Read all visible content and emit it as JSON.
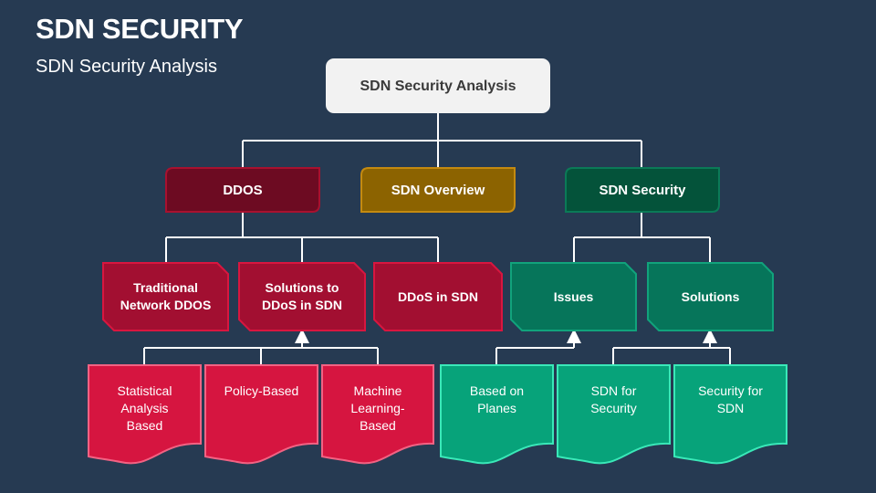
{
  "header": {
    "title": "SDN SECURITY",
    "subtitle": "SDN Security Analysis"
  },
  "colors": {
    "background": "#263a52",
    "connector": "#ffffff",
    "root_fill": "#f2f2f2",
    "ddos_fill": "#6d0b22",
    "ddos_stroke": "#a8112f",
    "overview_fill": "#8c6300",
    "overview_stroke": "#c48a10",
    "security_fill": "#04533a",
    "security_stroke": "#0b7a57",
    "red_mid_fill": "#a20f31",
    "red_mid_stroke": "#d9163f",
    "green_mid_fill": "#06755a",
    "green_mid_stroke": "#11a37c",
    "red_doc_fill": "#d61540",
    "red_doc_stroke": "#f26283",
    "green_doc_fill": "#07a37a",
    "green_doc_stroke": "#3ae8b8"
  },
  "diagram": {
    "root": {
      "label": "SDN Security Analysis"
    },
    "level1": [
      {
        "id": "ddos",
        "label": "DDOS"
      },
      {
        "id": "overview",
        "label": "SDN Overview"
      },
      {
        "id": "security",
        "label": "SDN Security"
      }
    ],
    "level2": [
      {
        "id": "traditional",
        "label": "Traditional Network DDOS",
        "parent": "ddos"
      },
      {
        "id": "solutions-ddos",
        "label": "Solutions to DDoS in SDN",
        "parent": "ddos"
      },
      {
        "id": "ddos-in-sdn",
        "label": "DDoS in SDN",
        "parent": "ddos"
      },
      {
        "id": "issues",
        "label": "Issues",
        "parent": "security"
      },
      {
        "id": "solutions",
        "label": "Solutions",
        "parent": "security"
      }
    ],
    "level3": [
      {
        "id": "statistical",
        "label": "Statistical Analysis Based",
        "parent": "solutions-ddos"
      },
      {
        "id": "policy",
        "label": "Policy-Based",
        "parent": "solutions-ddos"
      },
      {
        "id": "ml",
        "label": "Machine Learning-Based",
        "parent": "solutions-ddos"
      },
      {
        "id": "planes",
        "label": "Based on Planes",
        "parent": "issues"
      },
      {
        "id": "sdn-for-security",
        "label": "SDN for Security",
        "parent": "solutions"
      },
      {
        "id": "security-for-sdn",
        "label": "Security for SDN",
        "parent": "solutions"
      }
    ]
  }
}
